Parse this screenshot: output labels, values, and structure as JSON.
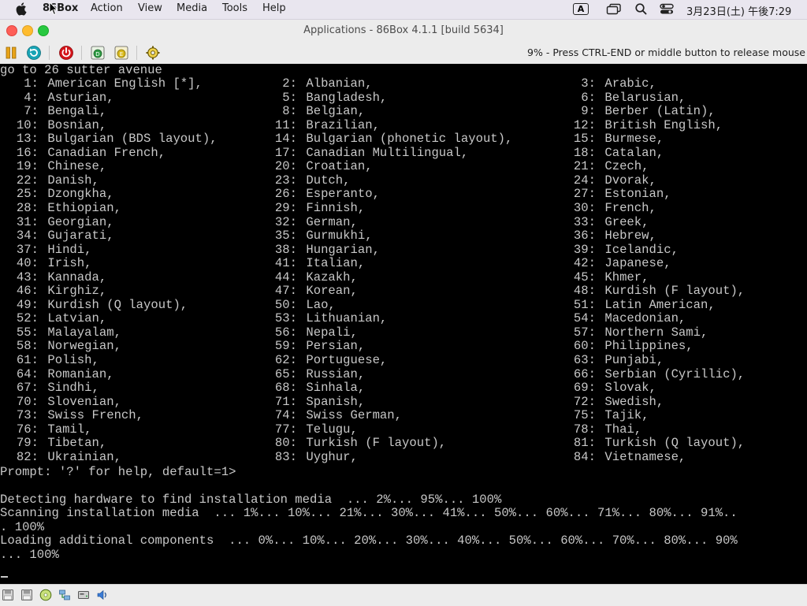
{
  "menubar": {
    "app_name": "86Box",
    "items": [
      "Action",
      "View",
      "Media",
      "Tools",
      "Help"
    ],
    "ime_label": "A",
    "clock": "3月23日(土) 午後7:29"
  },
  "window": {
    "title": "Applications - 86Box 4.1.1 [build 5634]"
  },
  "toolbar": {
    "status_message": "9% - Press CTRL-END or middle button to release mouse"
  },
  "screen": {
    "header_line": "go to 26 sutter avenue",
    "layouts": [
      [
        "1: American English [*],",
        "2: Albanian,",
        "3: Arabic,"
      ],
      [
        "4: Asturian,",
        "5: Bangladesh,",
        "6: Belarusian,"
      ],
      [
        "7: Bengali,",
        "8: Belgian,",
        "9: Berber (Latin),"
      ],
      [
        "10: Bosnian,",
        "11: Brazilian,",
        "12: British English,"
      ],
      [
        "13: Bulgarian (BDS layout),",
        "14: Bulgarian (phonetic layout),",
        "15: Burmese,"
      ],
      [
        "16: Canadian French,",
        "17: Canadian Multilingual,",
        "18: Catalan,"
      ],
      [
        "19: Chinese,",
        "20: Croatian,",
        "21: Czech,"
      ],
      [
        "22: Danish,",
        "23: Dutch,",
        "24: Dvorak,"
      ],
      [
        "25: Dzongkha,",
        "26: Esperanto,",
        "27: Estonian,"
      ],
      [
        "28: Ethiopian,",
        "29: Finnish,",
        "30: French,"
      ],
      [
        "31: Georgian,",
        "32: German,",
        "33: Greek,"
      ],
      [
        "34: Gujarati,",
        "35: Gurmukhi,",
        "36: Hebrew,"
      ],
      [
        "37: Hindi,",
        "38: Hungarian,",
        "39: Icelandic,"
      ],
      [
        "40: Irish,",
        "41: Italian,",
        "42: Japanese,"
      ],
      [
        "43: Kannada,",
        "44: Kazakh,",
        "45: Khmer,"
      ],
      [
        "46: Kirghiz,",
        "47: Korean,",
        "48: Kurdish (F layout),"
      ],
      [
        "49: Kurdish (Q layout),",
        "50: Lao,",
        "51: Latin American,"
      ],
      [
        "52: Latvian,",
        "53: Lithuanian,",
        "54: Macedonian,"
      ],
      [
        "55: Malayalam,",
        "56: Nepali,",
        "57: Northern Sami,"
      ],
      [
        "58: Norwegian,",
        "59: Persian,",
        "60: Philippines,"
      ],
      [
        "61: Polish,",
        "62: Portuguese,",
        "63: Punjabi,"
      ],
      [
        "64: Romanian,",
        "65: Russian,",
        "66: Serbian (Cyrillic),"
      ],
      [
        "67: Sindhi,",
        "68: Sinhala,",
        "69: Slovak,"
      ],
      [
        "70: Slovenian,",
        "71: Spanish,",
        "72: Swedish,"
      ],
      [
        "73: Swiss French,",
        "74: Swiss German,",
        "75: Tajik,"
      ],
      [
        "76: Tamil,",
        "77: Telugu,",
        "78: Thai,"
      ],
      [
        "79: Tibetan,",
        "80: Turkish (F layout),",
        "81: Turkish (Q layout),"
      ],
      [
        "82: Ukrainian,",
        "83: Uyghur,",
        "84: Vietnamese,"
      ]
    ],
    "prompt_line": "Prompt: '?' for help, default=1>",
    "log_lines": [
      "",
      "Detecting hardware to find installation media  ... 2%... 95%... 100%",
      "Scanning installation media  ... 1%... 10%... 21%... 30%... 41%... 50%... 60%... 71%... 80%... 91%..",
      ". 100%",
      "Loading additional components  ... 0%... 10%... 20%... 30%... 40%... 50%... 60%... 70%... 80%... 90%",
      "... 100%"
    ]
  },
  "colors": {
    "terminal_bg": "#000000",
    "terminal_fg": "#c8c8c8",
    "close": "#fe5f57",
    "minimize": "#febc2e",
    "maximize": "#28c840"
  },
  "icons": {
    "toolbar": [
      "pause-icon",
      "reset-icon",
      "power-icon",
      "ctrl-alt-del-icon",
      "ctrl-alt-esc-icon",
      "settings-icon"
    ],
    "statusbar": [
      "floppy-drive-1-icon",
      "floppy-drive-2-icon",
      "cdrom-icon",
      "network-icon",
      "hard-disk-icon",
      "sound-icon"
    ]
  }
}
